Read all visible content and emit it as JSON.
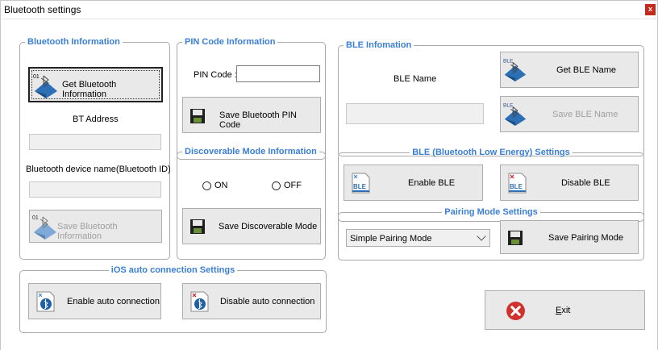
{
  "window": {
    "title": "Bluetooth settings",
    "close_glyph": "x"
  },
  "bt_info": {
    "legend": "Bluetooth Information",
    "get_btn": "Get Bluetooth Information",
    "bt_address_label": "BT Address",
    "bt_address_value": "",
    "device_name_label": "Bluetooth device name(Bluetooth ID)",
    "device_name_value": "",
    "save_btn": "Save Bluetooth Information",
    "icon_badge": "01"
  },
  "pin": {
    "legend": "PIN Code Information",
    "label": "PIN Code :",
    "value": "",
    "save_btn": "Save Bluetooth PIN Code"
  },
  "discoverable": {
    "legend": "Discoverable Mode Information",
    "on_label": "ON",
    "off_label": "OFF",
    "save_btn": "Save Discoverable Mode"
  },
  "ble_info": {
    "legend": "BLE Infomation",
    "name_label": "BLE Name",
    "get_btn": "Get BLE Name",
    "name_value": "",
    "save_btn": "Save BLE Name",
    "icon_badge": "BLE"
  },
  "ble_settings": {
    "legend": "BLE (Bluetooth Low Energy) Settings",
    "enable_btn": "Enable BLE",
    "disable_btn": "Disable BLE",
    "icon_text": "BLE"
  },
  "pairing": {
    "legend": "Pairing Mode Settings",
    "selected": "Simple Pairing Mode",
    "save_btn": "Save Pairing Mode"
  },
  "ios": {
    "legend": "iOS auto connection Settings",
    "enable_btn": "Enable auto connection",
    "disable_btn": "Disable auto connection"
  },
  "exit": {
    "label_accel": "E",
    "label_rest": "xit"
  },
  "colors": {
    "accent": "#3a7fd5",
    "close_red": "#c42b1c",
    "exit_red": "#d0312d"
  }
}
